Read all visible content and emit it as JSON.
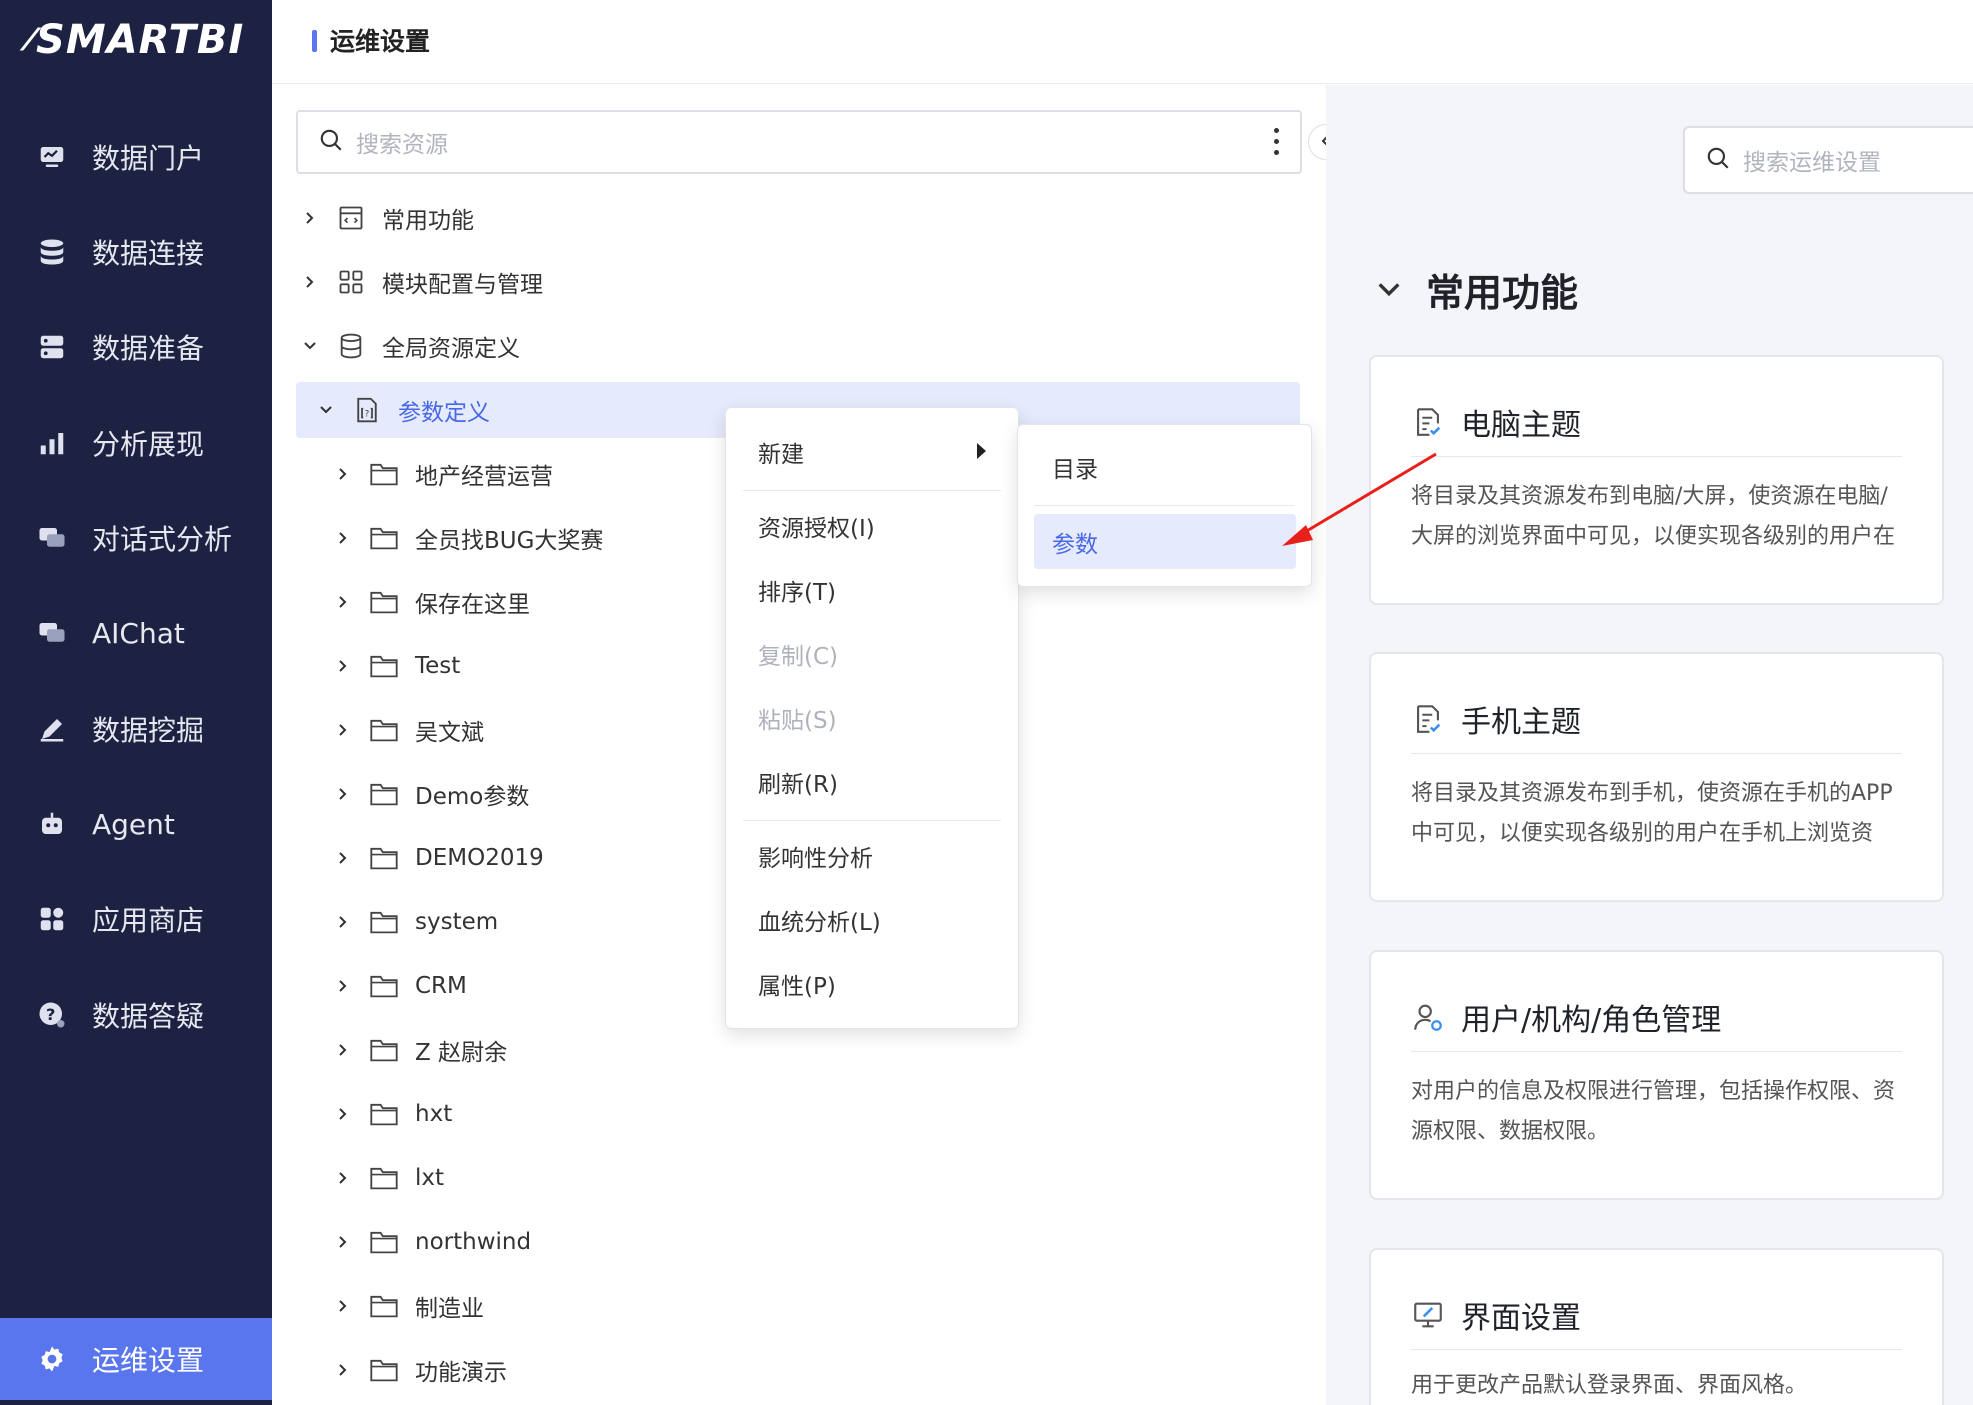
{
  "brand": {
    "logo_text": "SMARTBI"
  },
  "sidebar": {
    "items": [
      {
        "label": "数据门户",
        "icon": "monitor-icon"
      },
      {
        "label": "数据连接",
        "icon": "database-icon"
      },
      {
        "label": "数据准备",
        "icon": "server-icon"
      },
      {
        "label": "分析展现",
        "icon": "bar-chart-icon"
      },
      {
        "label": "对话式分析",
        "icon": "chat-icon"
      },
      {
        "label": "AIChat",
        "icon": "chat-icon"
      },
      {
        "label": "数据挖掘",
        "icon": "pencil-icon"
      },
      {
        "label": "Agent",
        "icon": "robot-icon"
      },
      {
        "label": "应用商店",
        "icon": "grid-icon"
      },
      {
        "label": "数据答疑",
        "icon": "question-icon"
      },
      {
        "label": "运维设置",
        "icon": "gear-icon",
        "active": true
      }
    ]
  },
  "header": {
    "title": "运维设置"
  },
  "tree": {
    "search_placeholder": "搜索资源",
    "top": [
      {
        "label": "常用功能",
        "expanded": false
      },
      {
        "label": "模块配置与管理",
        "expanded": false
      },
      {
        "label": "全局资源定义",
        "expanded": true
      }
    ],
    "selected": {
      "label": "参数定义"
    },
    "children": [
      "地产经营运营",
      "全员找BUG大奖赛",
      "保存在这里",
      "Test",
      "吴文斌",
      "Demo参数",
      "DEMO2019",
      "system",
      "CRM",
      "Z 赵尉余",
      "hxt",
      "lxt",
      "northwind",
      "制造业",
      "功能演示"
    ]
  },
  "context_menu": {
    "new": "新建",
    "grant": "资源授权(I)",
    "sort": "排序(T)",
    "copy": "复制(C)",
    "paste": "粘贴(S)",
    "refresh": "刷新(R)",
    "impact": "影响性分析",
    "lineage": "血统分析(L)",
    "props": "属性(P)"
  },
  "submenu": {
    "directory": "目录",
    "parameter": "参数"
  },
  "right": {
    "search_placeholder": "搜索运维设置",
    "section_title": "常用功能",
    "cards": [
      {
        "title": "电脑主题",
        "desc": "将目录及其资源发布到电脑/大屏，使资源在电脑/大屏的浏览界面中可见，以便实现各级别的用户在电脑/大屏上浏览资源。"
      },
      {
        "title": "手机主题",
        "desc": "将目录及其资源发布到手机，使资源在手机的APP中可见，以便实现各级别的用户在手机上浏览资源。"
      },
      {
        "title": "用户/机构/角色管理",
        "desc": "对用户的信息及权限进行管理，包括操作权限、资源权限、数据权限。"
      },
      {
        "title": "界面设置",
        "desc": "用于更改产品默认登录界面、界面风格。"
      }
    ]
  },
  "colors": {
    "sidebar_bg": "#1d2242",
    "accent": "#5a76ee",
    "annotation_arrow": "#e8201b"
  }
}
